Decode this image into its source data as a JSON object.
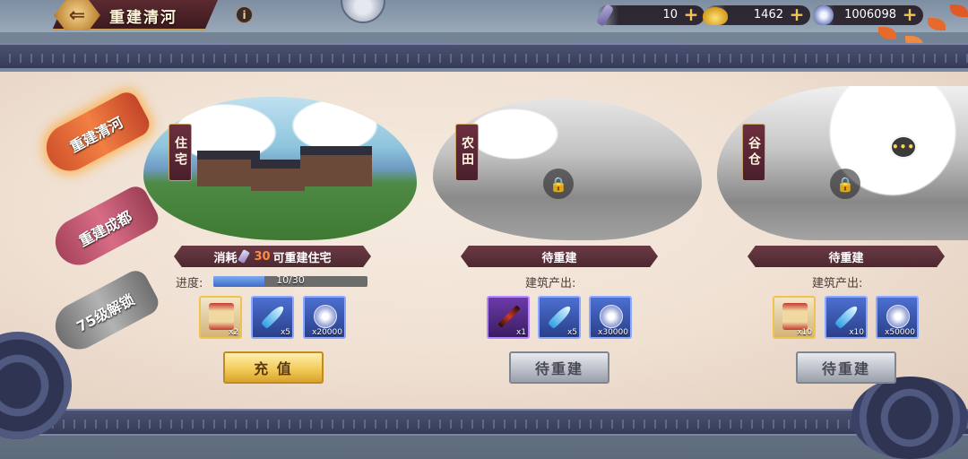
{
  "header": {
    "title": "重建清河",
    "info_label": "i",
    "back_label": "⇐"
  },
  "resources": [
    {
      "icon": "scroll-ticket-icon",
      "value": "10"
    },
    {
      "icon": "gold-ingot-icon",
      "value": "1462"
    },
    {
      "icon": "silver-coin-icon",
      "value": "1006098"
    }
  ],
  "sidebar": {
    "tabs": [
      {
        "label": "重建清河",
        "state": "active"
      },
      {
        "label": "重建成都",
        "state": "inactive"
      },
      {
        "label": "75级解锁",
        "state": "locked"
      }
    ]
  },
  "buildings": [
    {
      "name": "住宅",
      "status_prefix": "消耗",
      "status_cost": "30",
      "status_suffix": "可重建住宅",
      "progress_label": "进度:",
      "progress_text": "10/30",
      "progress_value": 0.333,
      "items": [
        {
          "icon": "scroll-icon",
          "count": "x2",
          "rarity": "gold"
        },
        {
          "icon": "feather-icon",
          "count": "x5",
          "rarity": "blue"
        },
        {
          "icon": "coin-icon",
          "count": "x20000",
          "rarity": "blue"
        }
      ],
      "button": "充 值",
      "locked": false
    },
    {
      "name": "农田",
      "status": "待重建",
      "output_label": "建筑产出:",
      "items": [
        {
          "icon": "sword-icon",
          "count": "x1",
          "rarity": "purple"
        },
        {
          "icon": "feather-icon",
          "count": "x5",
          "rarity": "blue"
        },
        {
          "icon": "coin-icon",
          "count": "x30000",
          "rarity": "blue"
        }
      ],
      "button": "待重建",
      "locked": true
    },
    {
      "name": "谷仓",
      "status": "待重建",
      "output_label": "建筑产出:",
      "items": [
        {
          "icon": "scroll-icon",
          "count": "x10",
          "rarity": "gold"
        },
        {
          "icon": "feather-icon",
          "count": "x10",
          "rarity": "blue"
        },
        {
          "icon": "coin-icon",
          "count": "x50000",
          "rarity": "blue"
        }
      ],
      "button": "待重建",
      "locked": true
    }
  ],
  "chat_icon_text": "•••"
}
